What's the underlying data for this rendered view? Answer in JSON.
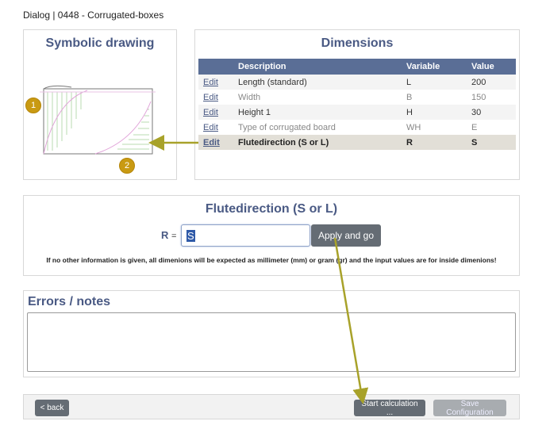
{
  "dialog_title": "Dialog | 0448 - Corrugated-boxes",
  "drawing": {
    "title": "Symbolic drawing",
    "markers": [
      "1",
      "2"
    ]
  },
  "dimensions": {
    "title": "Dimensions",
    "columns": [
      "",
      "Description",
      "Variable",
      "Value"
    ],
    "rows": [
      {
        "edit": "Edit",
        "description": "Length (standard)",
        "variable": "L",
        "value": "200"
      },
      {
        "edit": "Edit",
        "description": "Width",
        "variable": "B",
        "value": "150"
      },
      {
        "edit": "Edit",
        "description": "Height 1",
        "variable": "H",
        "value": "30"
      },
      {
        "edit": "Edit",
        "description": "Type of corrugated board",
        "variable": "WH",
        "value": "E"
      },
      {
        "edit": "Edit",
        "description": "Flutedirection (S or L)",
        "variable": "R",
        "value": "S"
      }
    ]
  },
  "input_section": {
    "title": "Flutedirection (S or L)",
    "variable": "R",
    "equals": "=",
    "value": "S",
    "apply_label": "Apply and go",
    "info": "If no other information is given, all dimenions will be expected as millimeter (mm) or gram (gr) and the input values are for inside dimenions!"
  },
  "errors": {
    "title": "Errors / notes",
    "value": ""
  },
  "footer": {
    "back_label": "< back",
    "calc_label": "Start calculation ...",
    "save_label": "Save Configuration"
  },
  "colors": {
    "accent": "#4a5a84",
    "header": "#5a6e96",
    "button": "#656c74",
    "arrow": "#a8a22a",
    "marker": "#c99a12"
  }
}
